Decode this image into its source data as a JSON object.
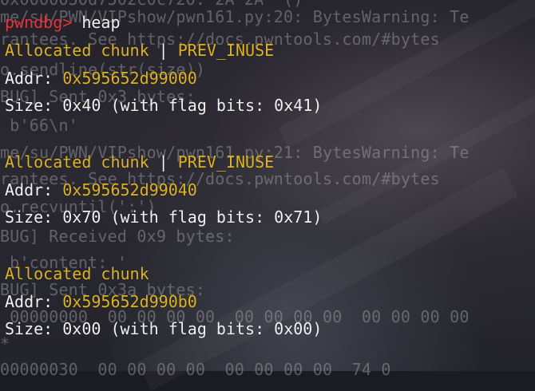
{
  "terminal": {
    "prompt": "pwndbg>",
    "command": "heap",
    "top_cut_line": "0x0000050d7502c0c720: 2A 2A  ()",
    "chunks": [
      {
        "status": "Allocated chunk",
        "flag_sep": " | ",
        "flag": "PREV_INUSE",
        "addr_label": "Addr: ",
        "addr": "0x595652d99000",
        "size_line": "Size: 0x40 (with flag bits: 0x41)"
      },
      {
        "status": "Allocated chunk",
        "flag_sep": " | ",
        "flag": "PREV_INUSE",
        "addr_label": "Addr: ",
        "addr": "0x595652d99040",
        "size_line": "Size: 0x70 (with flag bits: 0x71)"
      },
      {
        "status": "Allocated chunk",
        "flag_sep": "",
        "flag": "",
        "addr_label": "Addr: ",
        "addr": "0x595652d990b0",
        "size_line": "Size: 0x00 (with flag bits: 0x00)"
      }
    ],
    "background_lines": [
      "me/su/PWN/VIPshow/pwn161.py:20: BytesWarning: Te",
      "rantees. See https://docs.pwntools.com/#bytes",
      "o.sendline(str(size))",
      "BUG] Sent 0x3 bytes:",
      " b'66\\n'",
      "me/su/PWN/VIPshow/pwn161.py:21: BytesWarning: Te",
      "rantees. See https://docs.pwntools.com/#bytes",
      "o.recvuntil(':')",
      "BUG] Received 0x9 bytes:",
      " b'content: '",
      "BUG] Sent 0x3a bytes:",
      " 00000000  00 00 00 00  00 00 00 00  00 00 00 00",
      "*",
      "00000030  00 00 00 00  00 00 00 00  74 0"
    ]
  },
  "colors": {
    "prompt": "#e8343f",
    "highlight": "#e0b41c",
    "text": "#f2f2f2"
  }
}
